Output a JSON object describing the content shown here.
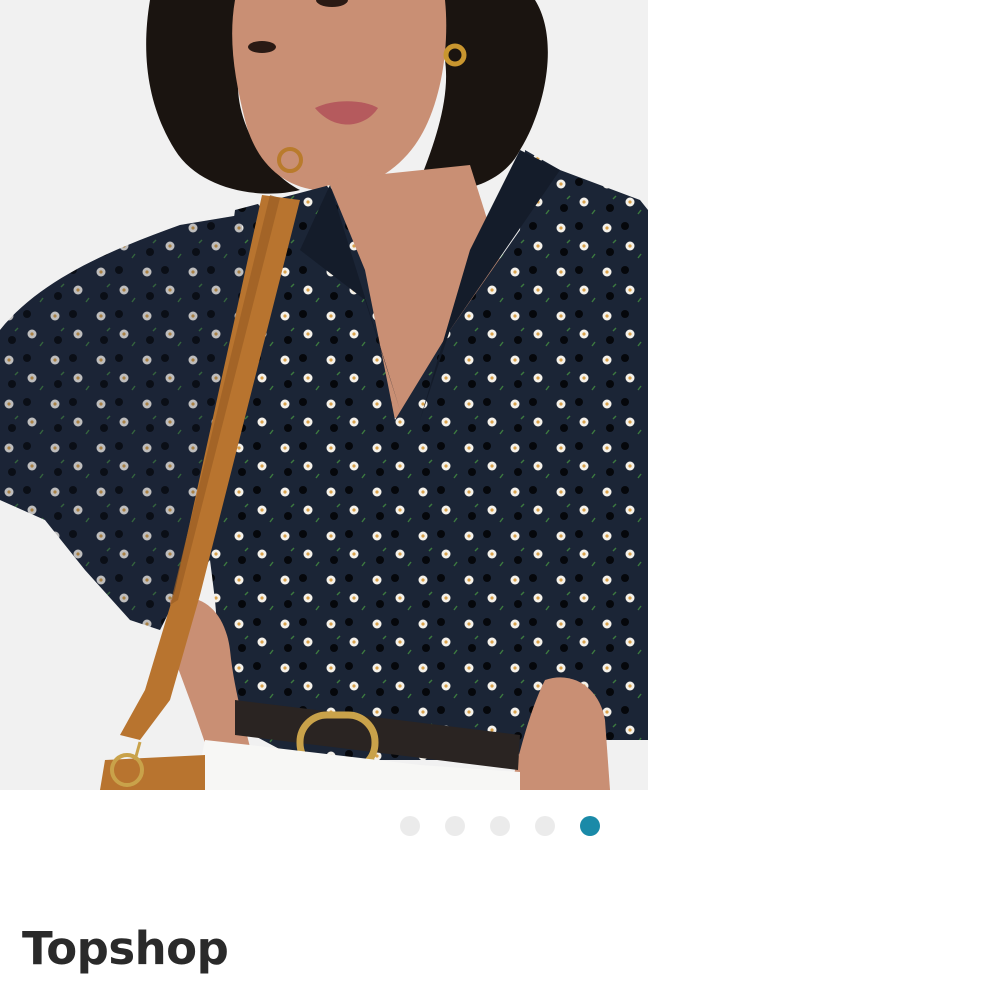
{
  "product": {
    "brand": "Topshop",
    "image": {
      "subject": "model-wearing-floral-blouse"
    }
  },
  "carousel": {
    "dots": [
      {
        "label": "",
        "active": false
      },
      {
        "label": "",
        "active": false
      },
      {
        "label": "",
        "active": false
      },
      {
        "label": "",
        "active": false
      },
      {
        "label": "",
        "active": true
      }
    ],
    "active_index": 4,
    "inactive_color": "#ebebeb",
    "active_color": "#1a8aa8"
  },
  "colors": {
    "blouse": "#1b2536",
    "background": "#f1f1f1",
    "bag_strap": "#b8742f",
    "belt": "#2a2422"
  }
}
